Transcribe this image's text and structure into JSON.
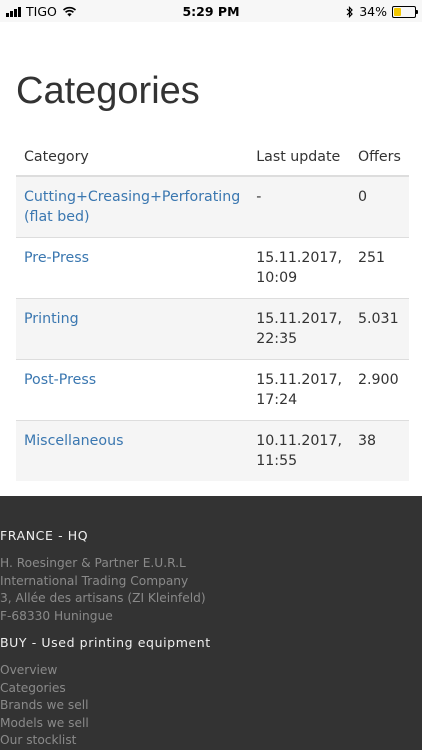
{
  "status_bar": {
    "carrier": "TIGO",
    "time": "5:29 PM",
    "battery_percent": "34%",
    "battery_level": 0.34,
    "battery_color": "#f2c700",
    "icons": [
      "signal-icon",
      "wifi-icon",
      "bluetooth-icon",
      "battery-icon"
    ]
  },
  "page": {
    "title": "Categories"
  },
  "table": {
    "headers": {
      "category": "Category",
      "last_update": "Last update",
      "offers": "Offers"
    },
    "rows": [
      {
        "category": "Cutting+Creasing+Perforating (flat bed)",
        "last_update": "-",
        "offers": "0"
      },
      {
        "category": "Pre-Press",
        "last_update": "15.11.2017, 10:09",
        "offers": "251"
      },
      {
        "category": "Printing",
        "last_update": "15.11.2017, 22:35",
        "offers": "5.031"
      },
      {
        "category": "Post-Press",
        "last_update": "15.11.2017, 17:24",
        "offers": "2.900"
      },
      {
        "category": "Miscellaneous",
        "last_update": "10.11.2017, 11:55",
        "offers": "38"
      }
    ],
    "link_color": "#3a77b0"
  },
  "footer": {
    "hq": {
      "heading": "FRANCE - HQ",
      "lines": [
        "H. Roesinger & Partner E.U.R.L",
        "International Trading Company",
        "3, Allée des artisans (ZI Kleinfeld)",
        "F-68330 Huningue"
      ]
    },
    "buy": {
      "heading": "BUY - Used printing equipment",
      "links": [
        "Overview",
        "Categories",
        "Brands we sell",
        "Models we sell",
        "Our stocklist"
      ]
    },
    "background": "#333333"
  }
}
